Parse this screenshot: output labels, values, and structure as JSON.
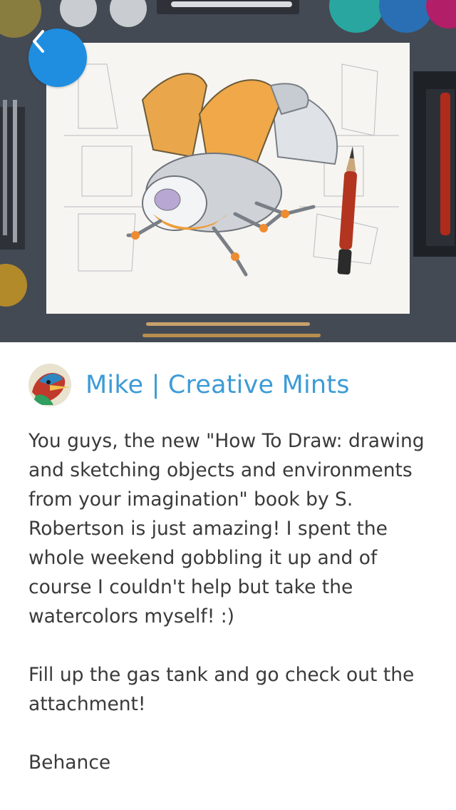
{
  "header": {
    "back_button": {
      "icon": "chevron-left-icon",
      "color": "#1f8ee0"
    },
    "hero_image": "illustration-drawing-of-mechanical-beetle"
  },
  "post": {
    "author": "Mike | Creative Mints",
    "author_color": "#3d9bd6",
    "paragraphs": [
      "You guys, the new \"How To Draw: drawing and sketching objects and environments from your imagination\" book by S. Robertson is just amazing! I spent the whole weekend gobbling it up and of course I couldn't help but take the watercolors myself! :)",
      "Fill up the gas tank and go check out the attachment!",
      "Behance"
    ]
  }
}
